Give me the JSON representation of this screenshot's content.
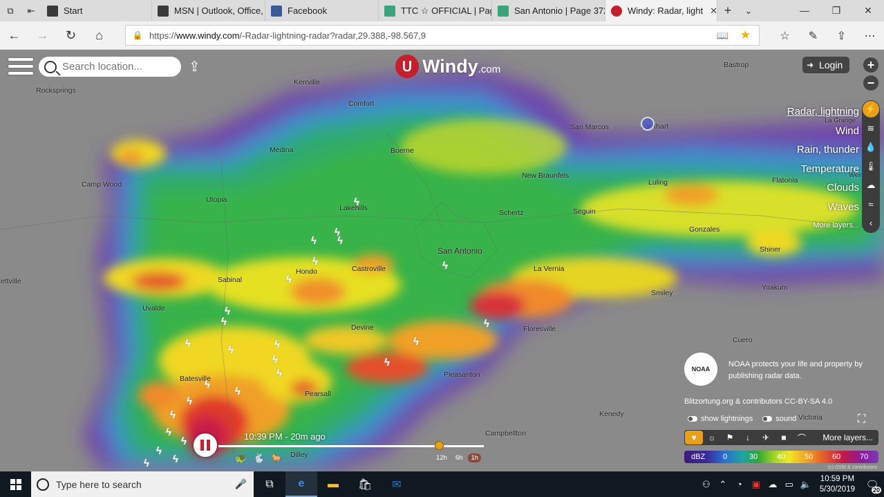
{
  "browser": {
    "tabs": [
      {
        "label": "Start",
        "color": "#3a3a3a"
      },
      {
        "label": "MSN | Outlook, Office,",
        "color": "#3a3a3a"
      },
      {
        "label": "Facebook",
        "color": "#3b5998"
      },
      {
        "label": "TTC ☆ OFFICIAL | Page",
        "color": "#3aa57a"
      },
      {
        "label": "San Antonio | Page 372",
        "color": "#3aa57a"
      },
      {
        "label": "Windy: Radar, light",
        "color": "#c41f2a"
      }
    ],
    "url_prefix": "https://",
    "url_host": "www.windy.com",
    "url_path": "/-Radar-lightning-radar?radar,29.388,-98.567,9"
  },
  "windy": {
    "search_placeholder": "Search location...",
    "logo_text": "Windy",
    "logo_domain": ".com",
    "login_label": "Login",
    "zoom_in": "+",
    "zoom_out": "−",
    "layers": [
      "Radar, lightning",
      "Wind",
      "Rain, thunder",
      "Temperature",
      "Clouds",
      "Waves",
      "More layers..."
    ],
    "noaa_badge": "NOAA",
    "noaa_text": "NOAA protects your life and property by publishing radar data.",
    "credit": "Blitzortung.org & contributors CC-BY-SA 4.0",
    "toggle_lightnings": "show lightnings",
    "toggle_sound": "sound",
    "overlay_more": "More layers...",
    "legend_unit": "dBZ",
    "legend_values": [
      "0",
      "30",
      "40",
      "50",
      "60",
      "70"
    ],
    "osm_credit": "(c) OSM & contributors",
    "player_time": "10:39 PM - 20m ago",
    "ranges": [
      "12h",
      "6h",
      "1h"
    ],
    "selected_range": "1h",
    "playback_progress": 0.83
  },
  "map": {
    "towns": [
      {
        "name": "Rocksprings"
      },
      {
        "name": "Kerrville"
      },
      {
        "name": "Comfort"
      },
      {
        "name": "Bastrop"
      },
      {
        "name": "San Marcos"
      },
      {
        "name": "Lockhart"
      },
      {
        "name": "La Grange"
      },
      {
        "name": "Medina"
      },
      {
        "name": "Boerne"
      },
      {
        "name": "Camp Wood"
      },
      {
        "name": "Utopia"
      },
      {
        "name": "New Braunfels"
      },
      {
        "name": "Luling"
      },
      {
        "name": "Flatonia"
      },
      {
        "name": "Lakehills"
      },
      {
        "name": "Schertz"
      },
      {
        "name": "Seguin"
      },
      {
        "name": "Gonzales"
      },
      {
        "name": "San Antonio"
      },
      {
        "name": "Shiner"
      },
      {
        "name": "Castroville"
      },
      {
        "name": "La Vernia"
      },
      {
        "name": "Hondo"
      },
      {
        "name": "Sabinal"
      },
      {
        "name": "Brackettville"
      },
      {
        "name": "Yoakum"
      },
      {
        "name": "Smiley"
      },
      {
        "name": "Uvalde"
      },
      {
        "name": "Devine"
      },
      {
        "name": "Floresville"
      },
      {
        "name": "Cuero"
      },
      {
        "name": "Pleasanton"
      },
      {
        "name": "Batesville"
      },
      {
        "name": "Pearsall"
      },
      {
        "name": "Kenedy"
      },
      {
        "name": "Victoria"
      },
      {
        "name": "Campbellton"
      },
      {
        "name": "Dilley"
      },
      {
        "name": "Weimar"
      }
    ]
  },
  "taskbar": {
    "search_placeholder": "Type here to search",
    "time": "10:59 PM",
    "date": "5/30/2019",
    "notifications": "20"
  }
}
